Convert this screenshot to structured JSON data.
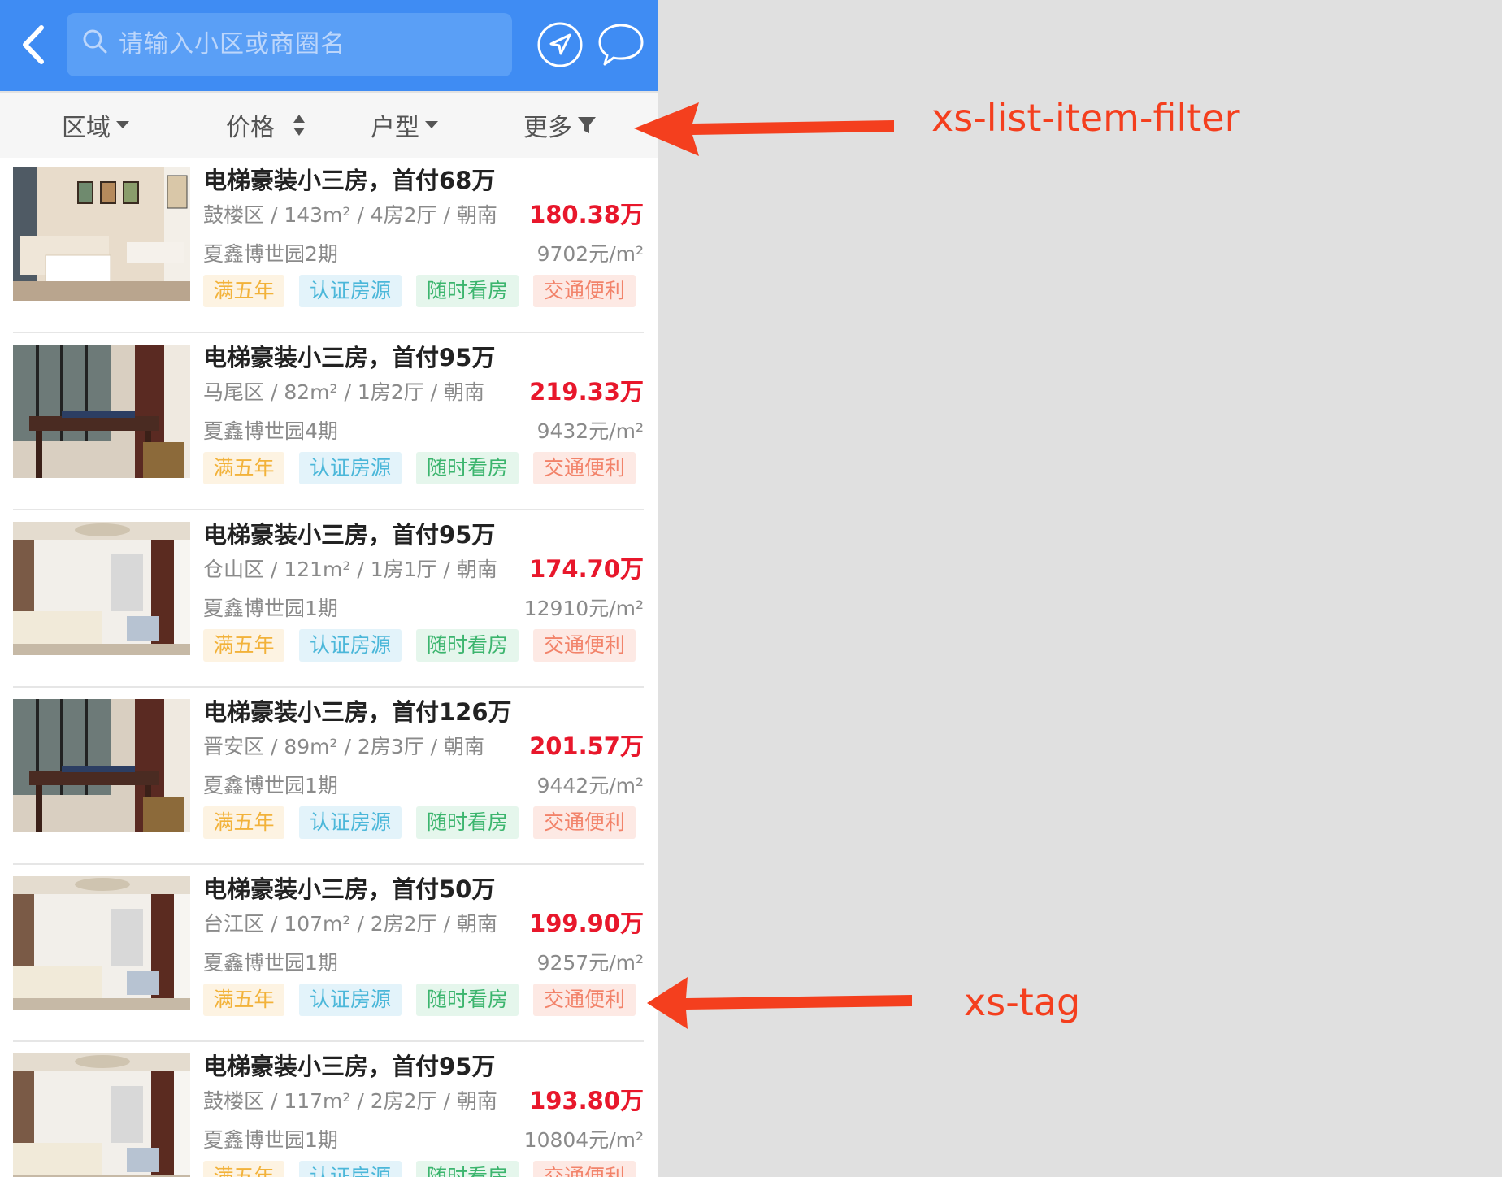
{
  "header": {
    "search_placeholder": "请输入小区或商圈名"
  },
  "filters": [
    {
      "label": "区域"
    },
    {
      "label": "价格"
    },
    {
      "label": "户型"
    },
    {
      "label": "更多"
    }
  ],
  "listings": [
    {
      "title": "电梯豪装小三房，首付68万",
      "district": "鼓楼区",
      "area": "143m²",
      "layout": "4房2厅",
      "facing": "朝南",
      "specs": "鼓楼区 / 143m² / 4房2厅 / 朝南",
      "price": "180.38万",
      "estate": "夏鑫博世园2期",
      "unit_price": "9702元/m²",
      "tags": [
        "满五年",
        "认证房源",
        "随时看房",
        "交通便利"
      ]
    },
    {
      "title": "电梯豪装小三房，首付95万",
      "district": "马尾区",
      "area": "82m²",
      "layout": "1房2厅",
      "facing": "朝南",
      "specs": "马尾区 / 82m² / 1房2厅 / 朝南",
      "price": "219.33万",
      "estate": "夏鑫博世园4期",
      "unit_price": "9432元/m²",
      "tags": [
        "满五年",
        "认证房源",
        "随时看房",
        "交通便利"
      ]
    },
    {
      "title": "电梯豪装小三房，首付95万",
      "district": "仓山区",
      "area": "121m²",
      "layout": "1房1厅",
      "facing": "朝南",
      "specs": "仓山区 / 121m² / 1房1厅 / 朝南",
      "price": "174.70万",
      "estate": "夏鑫博世园1期",
      "unit_price": "12910元/m²",
      "tags": [
        "满五年",
        "认证房源",
        "随时看房",
        "交通便利"
      ]
    },
    {
      "title": "电梯豪装小三房，首付126万",
      "district": "晋安区",
      "area": "89m²",
      "layout": "2房3厅",
      "facing": "朝南",
      "specs": "晋安区 / 89m² / 2房3厅 / 朝南",
      "price": "201.57万",
      "estate": "夏鑫博世园1期",
      "unit_price": "9442元/m²",
      "tags": [
        "满五年",
        "认证房源",
        "随时看房",
        "交通便利"
      ]
    },
    {
      "title": "电梯豪装小三房，首付50万",
      "district": "台江区",
      "area": "107m²",
      "layout": "2房2厅",
      "facing": "朝南",
      "specs": "台江区 / 107m² / 2房2厅 / 朝南",
      "price": "199.90万",
      "estate": "夏鑫博世园1期",
      "unit_price": "9257元/m²",
      "tags": [
        "满五年",
        "认证房源",
        "随时看房",
        "交通便利"
      ]
    },
    {
      "title": "电梯豪装小三房，首付95万",
      "district": "鼓楼区",
      "area": "117m²",
      "layout": "2房2厅",
      "facing": "朝南",
      "specs": "鼓楼区 / 117m² / 2房2厅 / 朝南",
      "price": "193.80万",
      "estate": "夏鑫博世园1期",
      "unit_price": "10804元/m²",
      "tags": [
        "满五年",
        "认证房源",
        "随时看房",
        "交通便利"
      ]
    }
  ],
  "annotations": [
    {
      "label": "xs-list-item-filter"
    },
    {
      "label": "xs-tag"
    }
  ],
  "colors": {
    "header_bg": "#3f8cf3",
    "price": "#e8172b",
    "annotation": "#f43f1e",
    "tag_years": "#f2b23a",
    "tag_verified": "#4bb7d9",
    "tag_viewing": "#3cb56e",
    "tag_transport": "#f2836a"
  },
  "icons": [
    "back-arrow-icon",
    "search-icon",
    "location-arrow-icon",
    "chat-bubble-icon",
    "caret-down-icon",
    "sort-updown-icon",
    "filter-funnel-icon"
  ]
}
